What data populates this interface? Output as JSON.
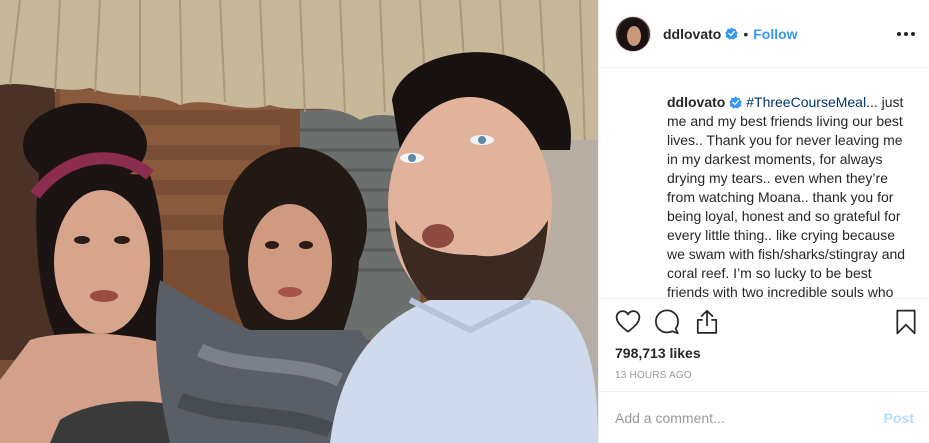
{
  "photo": {
    "subject": "selfie"
  },
  "header": {
    "username": "ddlovato",
    "separator": "•",
    "follow_label": "Follow",
    "more_icon": "more-options-icon",
    "verified_icon": "verified-badge-icon"
  },
  "caption": {
    "username": "ddlovato",
    "hashtag": "#ThreeCourseMeal",
    "text": "... just me and my best friends living our best lives.. Thank you for never leaving me in my darkest moments, for always drying my tears.. even when they’re from watching Moana.. thank you for being loyal, honest and so grateful for every little thing.. like crying because we swam with fish/sharks/stingray and coral reef. I’m so lucky to be best friends with two incredible souls who"
  },
  "actions": {
    "like_icon": "heart-icon",
    "comment_icon": "comment-icon",
    "share_icon": "share-icon",
    "save_icon": "bookmark-icon"
  },
  "likes": "798,713 likes",
  "timestamp": "13 HOURS AGO",
  "add_comment": {
    "placeholder": "Add a comment...",
    "post_label": "Post"
  },
  "colors": {
    "link_blue": "#3897f0",
    "hashtag": "#003569",
    "post_disabled": "#b2dffc",
    "muted": "#999999",
    "text": "#262626",
    "divider": "#efefef"
  }
}
